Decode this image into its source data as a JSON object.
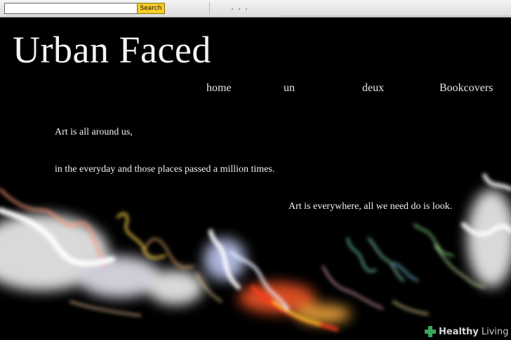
{
  "search": {
    "value": "",
    "button_label": "Search"
  },
  "site": {
    "title": "Urban Faced"
  },
  "nav": {
    "items": [
      {
        "label": "home"
      },
      {
        "label": "un"
      },
      {
        "label": "deux"
      },
      {
        "label": "Bookcovers"
      }
    ]
  },
  "content": {
    "line1": "Art is all around us,",
    "line2": "in the everyday and those places passed a million times.",
    "line3": "Art is everywhere, all we need do is look."
  },
  "watermark": {
    "brand": "Healthy",
    "suffix": "Living"
  },
  "colors": {
    "background": "#000000",
    "search_button": "#f5cc2a",
    "watermark_cross": "#3aa55c"
  }
}
